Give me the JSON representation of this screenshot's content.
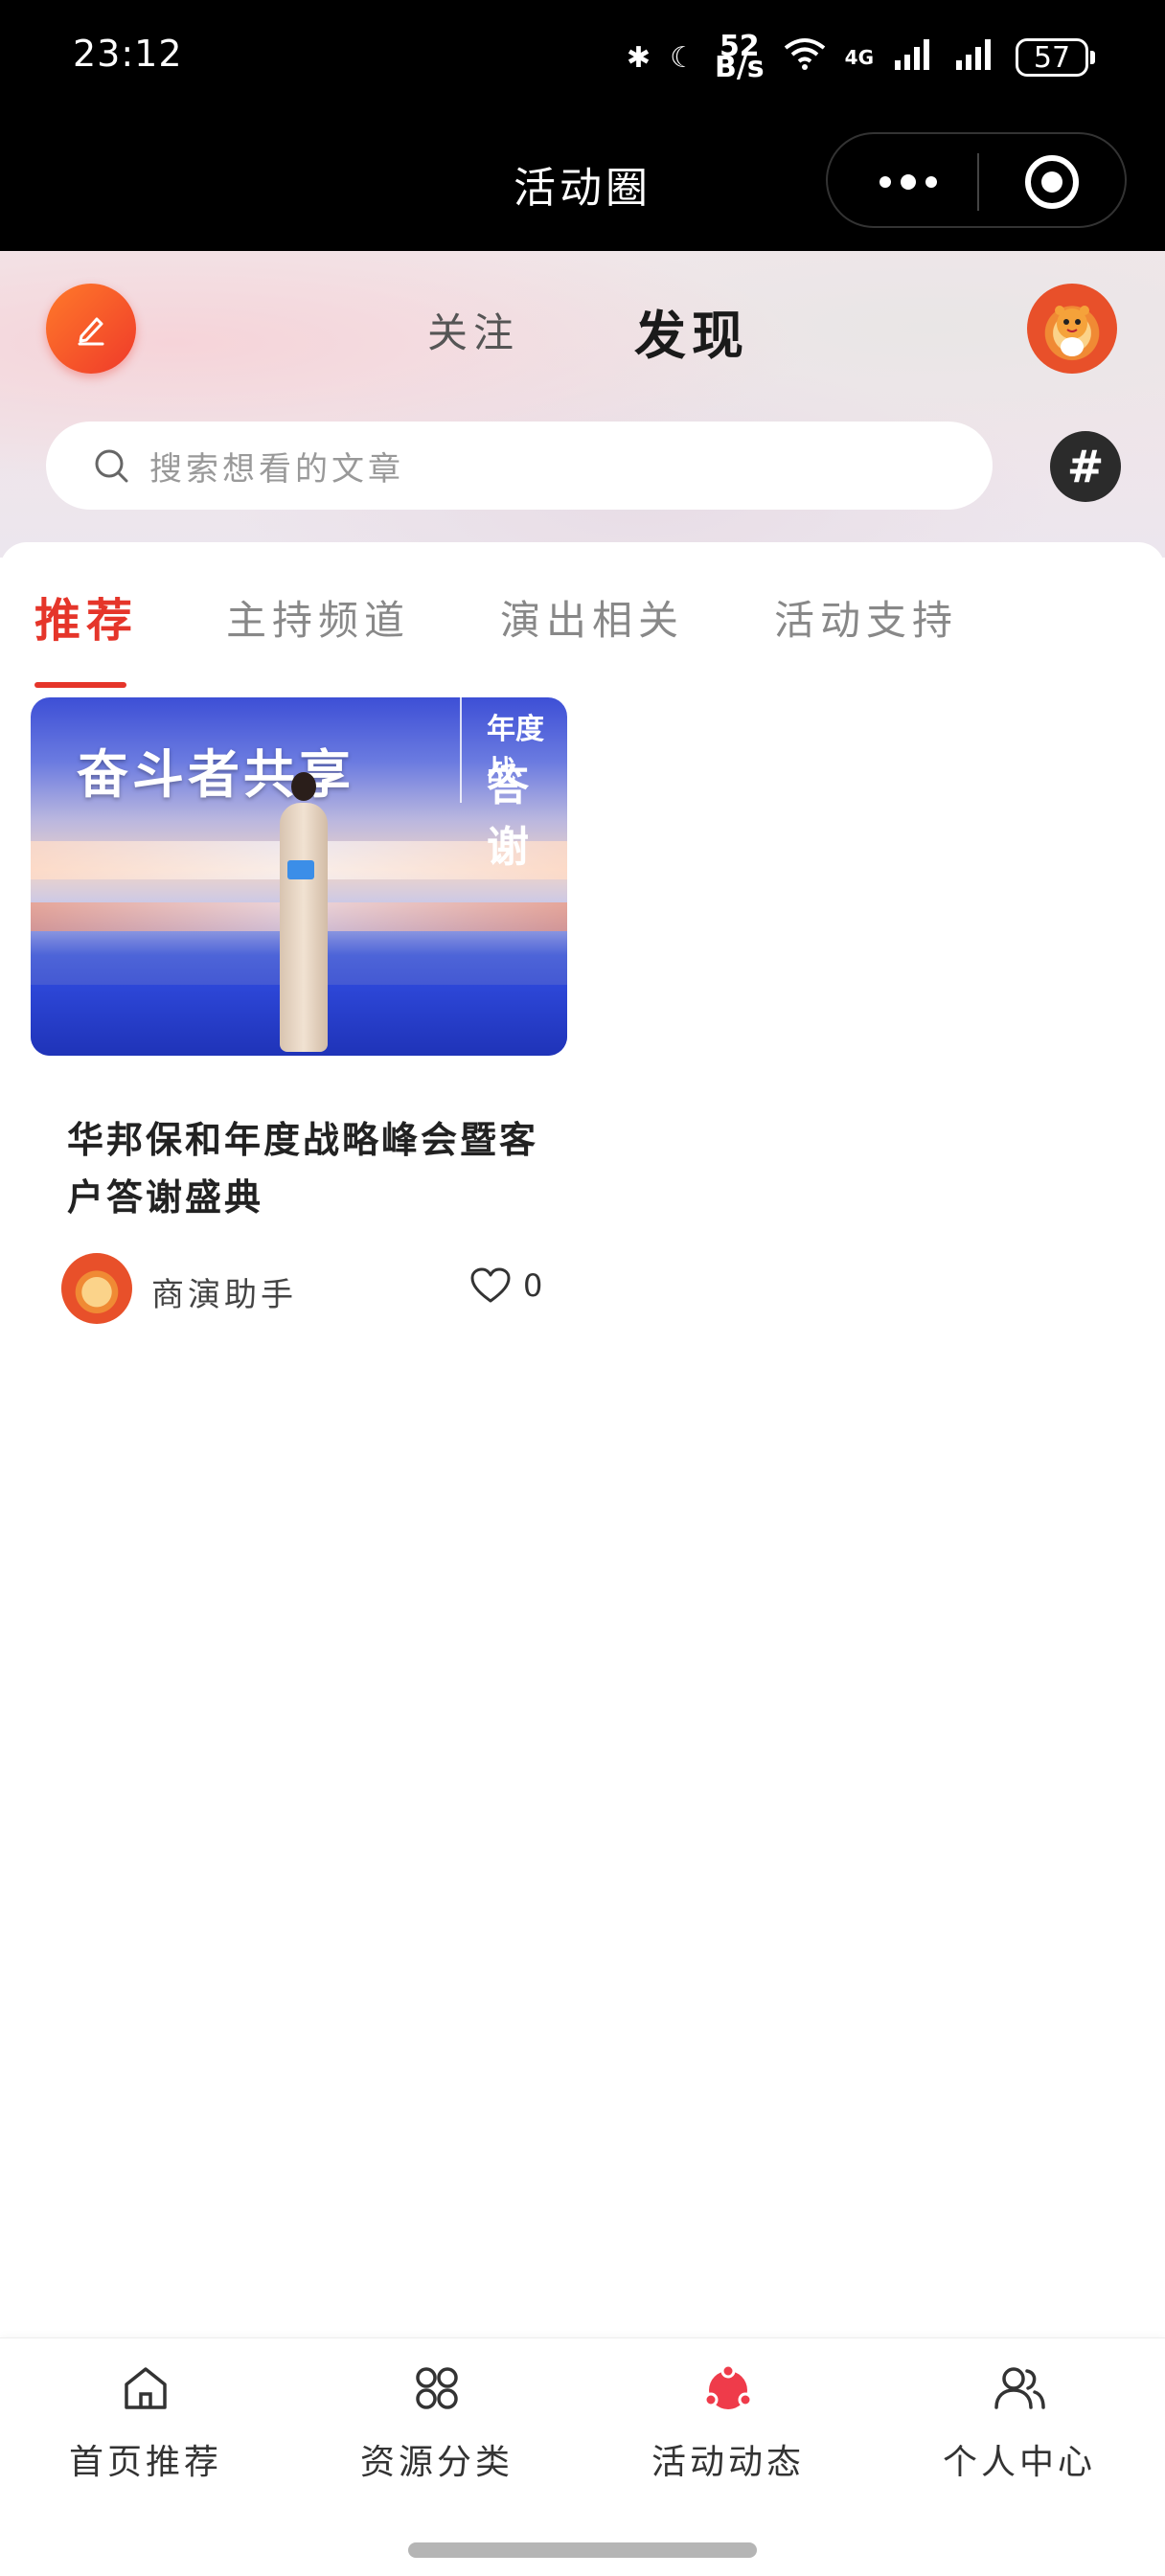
{
  "status_bar": {
    "time": "23:12",
    "net_speed_value": "52",
    "net_speed_unit": "B/s",
    "network": "4G",
    "battery": "57"
  },
  "title_bar": {
    "title": "活动圈"
  },
  "header": {
    "tab_follow": "关注",
    "tab_discover": "发现",
    "search_placeholder": "搜索想看的文章",
    "hash_symbol": "#"
  },
  "categories": [
    {
      "label": "推荐",
      "active": true
    },
    {
      "label": "主持频道",
      "active": false
    },
    {
      "label": "演出相关",
      "active": false
    },
    {
      "label": "活动支持",
      "active": false
    }
  ],
  "posts": [
    {
      "title": "华邦保和年度战略峰会暨客户答谢盛典",
      "author": "商演助手",
      "likes": "0",
      "image_text_main": "奋斗者共享",
      "image_text_side_1": "年度战",
      "image_text_side_2": "答谢"
    }
  ],
  "bottom_nav": [
    {
      "label": "首页推荐",
      "icon": "home-icon",
      "active": false
    },
    {
      "label": "资源分类",
      "icon": "grid-icon",
      "active": false
    },
    {
      "label": "活动动态",
      "icon": "activity-icon",
      "active": true
    },
    {
      "label": "个人中心",
      "icon": "users-icon",
      "active": false
    }
  ],
  "colors": {
    "accent": "#e5352a",
    "title_bar_bg": "#000000",
    "text_primary": "#222222",
    "text_muted": "#888888"
  }
}
